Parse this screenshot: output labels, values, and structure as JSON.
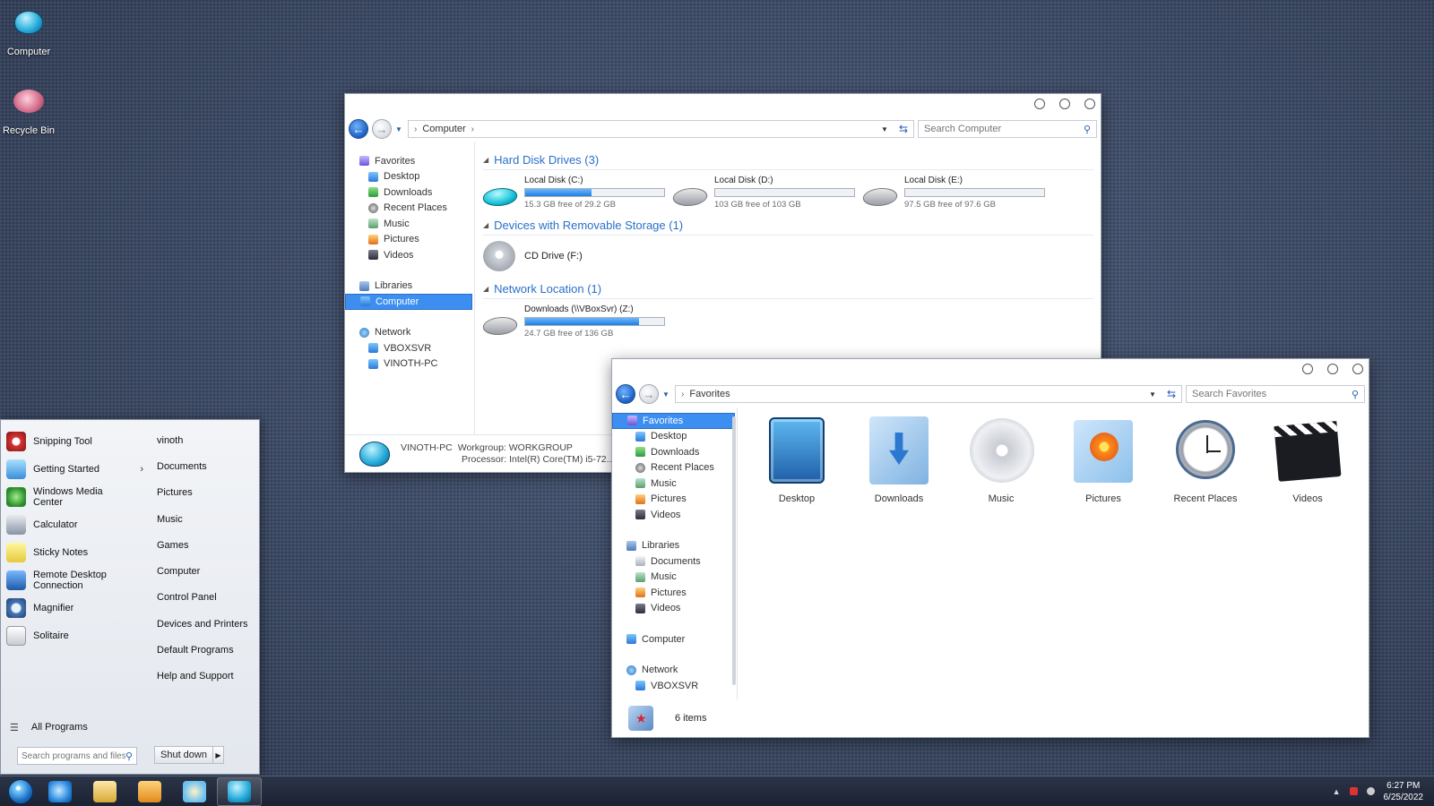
{
  "desktop": {
    "icons": [
      {
        "label": "Computer",
        "icon": "computer-icon"
      },
      {
        "label": "Recycle Bin",
        "icon": "recycle-bin-icon"
      }
    ]
  },
  "computer_window": {
    "address": "Computer",
    "search_placeholder": "Search Computer",
    "nav": {
      "favorites": "Favorites",
      "favorites_items": [
        "Desktop",
        "Downloads",
        "Recent Places",
        "Music",
        "Pictures",
        "Videos"
      ],
      "libraries": "Libraries",
      "computer": "Computer",
      "network": "Network",
      "network_items": [
        "VBOXSVR",
        "VINOTH-PC"
      ]
    },
    "groups": {
      "hdd": "Hard Disk Drives (3)",
      "removable": "Devices with Removable Storage (1)",
      "network": "Network Location (1)"
    },
    "drives": [
      {
        "name": "Local Disk (C:)",
        "free": "15.3 GB free of 29.2 GB",
        "used_fraction": 0.48
      },
      {
        "name": "Local Disk (D:)",
        "free": "103 GB free of 103 GB",
        "used_fraction": 0.0
      },
      {
        "name": "Local Disk (E:)",
        "free": "97.5 GB free of 97.6 GB",
        "used_fraction": 0.0
      }
    ],
    "cd_drive": "CD Drive (F:)",
    "net_drive": {
      "name": "Downloads (\\\\VBoxSvr) (Z:)",
      "free": "24.7 GB free of 136 GB",
      "used_fraction": 0.82
    },
    "details": {
      "pc_name": "VINOTH-PC",
      "workgroup": "Workgroup: WORKGROUP",
      "processor": "Processor: Intel(R) Core(TM) i5-72..."
    }
  },
  "favorites_window": {
    "address": "Favorites",
    "search_placeholder": "Search Favorites",
    "nav": {
      "favorites": "Favorites",
      "favorites_items": [
        "Desktop",
        "Downloads",
        "Recent Places",
        "Music",
        "Pictures",
        "Videos"
      ],
      "libraries": "Libraries",
      "libraries_items": [
        "Documents",
        "Music",
        "Pictures",
        "Videos"
      ],
      "computer": "Computer",
      "network": "Network",
      "network_items": [
        "VBOXSVR"
      ]
    },
    "items": [
      "Desktop",
      "Downloads",
      "Music",
      "Pictures",
      "Recent Places",
      "Videos"
    ],
    "status": "6 items"
  },
  "start_menu": {
    "programs": [
      {
        "label": "Snipping Tool",
        "icon": "snipping-tool-icon"
      },
      {
        "label": "Getting Started",
        "icon": "getting-started-icon",
        "has_submenu": true
      },
      {
        "label": "Windows Media\nCenter",
        "icon": "media-center-icon"
      },
      {
        "label": "Calculator",
        "icon": "calculator-icon"
      },
      {
        "label": "Sticky Notes",
        "icon": "sticky-notes-icon"
      },
      {
        "label": "Remote Desktop\nConnection",
        "icon": "remote-desktop-icon"
      },
      {
        "label": "Magnifier",
        "icon": "magnifier-icon"
      },
      {
        "label": "Solitaire",
        "icon": "solitaire-icon"
      }
    ],
    "all_programs": "All Programs",
    "right_items": [
      "vinoth",
      "Documents",
      "Pictures",
      "Music",
      "Games",
      "Computer",
      "Control Panel",
      "Devices and Printers",
      "Default Programs",
      "Help and Support"
    ],
    "search_placeholder": "Search programs and files",
    "shutdown": "Shut down"
  },
  "taskbar": {
    "pinned": [
      "internet-explorer-icon",
      "file-explorer-icon",
      "media-player-icon",
      "paint-icon",
      "computer-icon"
    ],
    "time": "6:27 PM",
    "date": "6/25/2022"
  }
}
